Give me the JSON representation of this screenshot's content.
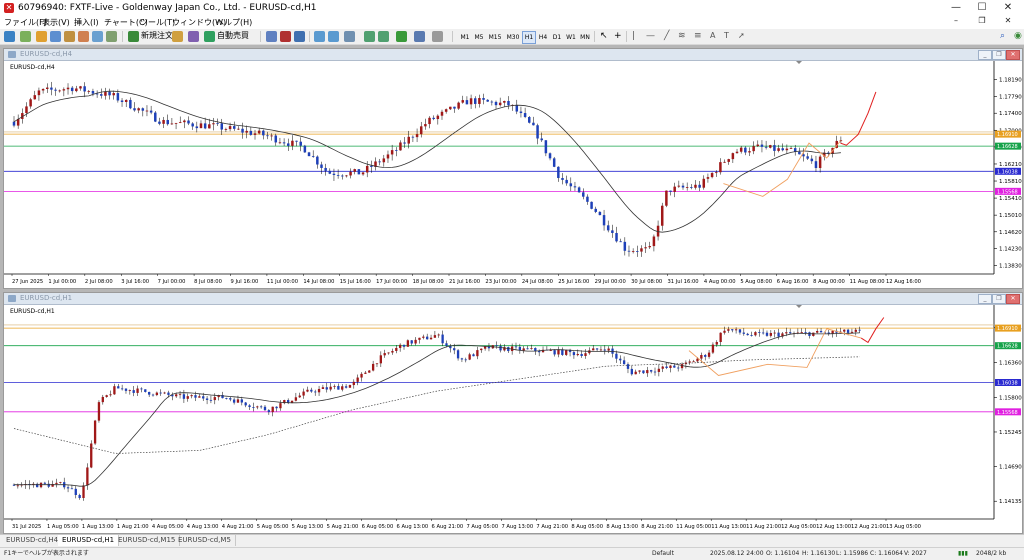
{
  "window": {
    "title": "60796940: FXTF-Live - Goldenway Japan Co., Ltd. - EURUSD-cd,H1",
    "minimize_glyph": "—",
    "maximize_glyph": "☐",
    "close_glyph": "✕",
    "app_icon": "mt4-app-icon"
  },
  "menu": [
    "ファイル(F)",
    "表示(V)",
    "挿入(I)",
    "チャート(C)",
    "ツール(T)",
    "ウィンドウ(W)",
    "ヘルプ(H)"
  ],
  "toolbar": {
    "new_order_label": "新規注文",
    "auto_trade_label": "自動売買",
    "timeframes": [
      "M1",
      "M5",
      "M15",
      "M30",
      "H1",
      "H4",
      "D1",
      "W1",
      "MN"
    ],
    "active_timeframe": "H1"
  },
  "chart_top": {
    "caption": "EURUSD-cd,H4",
    "symbol_label": "EURUSD-cd,H4",
    "price_ticks": [
      "1.18190",
      "1.17790",
      "1.17400",
      "1.17000",
      "1.16610",
      "1.16210",
      "1.15810",
      "1.15410",
      "1.15010",
      "1.14620",
      "1.14230",
      "1.13830"
    ],
    "price_tags": [
      {
        "text": "1.16910",
        "color": "#e8a020"
      },
      {
        "text": "1.16628",
        "color": "#16a34a"
      },
      {
        "text": "1.16038",
        "color": "#2a2ad0"
      },
      {
        "text": "1.15568",
        "color": "#e020e0"
      }
    ],
    "time_labels": [
      "27 Jun 2025",
      "1 Jul 00:00",
      "2 Jul 08:00",
      "3 Jul 16:00",
      "7 Jul 00:00",
      "8 Jul 08:00",
      "9 Jul 16:00",
      "11 Jul 00:00",
      "14 Jul 08:00",
      "15 Jul 16:00",
      "17 Jul 00:00",
      "18 Jul 08:00",
      "21 Jul 16:00",
      "23 Jul 00:00",
      "24 Jul 08:00",
      "25 Jul 16:00",
      "29 Jul 00:00",
      "30 Jul 08:00",
      "31 Jul 16:00",
      "4 Aug 00:00",
      "5 Aug 08:00",
      "6 Aug 16:00",
      "8 Aug 00:00",
      "11 Aug 08:00",
      "12 Aug 16:00"
    ]
  },
  "chart_bottom": {
    "caption": "EURUSD-cd,H1",
    "symbol_label": "EURUSD-cd,H1",
    "price_ticks": [
      "1.16915",
      "1.16360",
      "1.15800",
      "1.15245",
      "1.14690",
      "1.14135"
    ],
    "price_tags": [
      {
        "text": "1.16910",
        "color": "#e8a020"
      },
      {
        "text": "1.16628",
        "color": "#16a34a"
      },
      {
        "text": "1.16038",
        "color": "#2a2ad0"
      },
      {
        "text": "1.15568",
        "color": "#e020e0"
      }
    ],
    "time_labels": [
      "31 Jul 2025",
      "1 Aug 05:00",
      "1 Aug 13:00",
      "1 Aug 21:00",
      "4 Aug 05:00",
      "4 Aug 13:00",
      "4 Aug 21:00",
      "5 Aug 05:00",
      "5 Aug 13:00",
      "5 Aug 21:00",
      "6 Aug 05:00",
      "6 Aug 13:00",
      "6 Aug 21:00",
      "7 Aug 05:00",
      "7 Aug 13:00",
      "7 Aug 21:00",
      "8 Aug 05:00",
      "8 Aug 13:00",
      "8 Aug 21:00",
      "11 Aug 05:00",
      "11 Aug 13:00",
      "11 Aug 21:00",
      "12 Aug 05:00",
      "12 Aug 13:00",
      "12 Aug 21:00",
      "13 Aug 05:00"
    ]
  },
  "levels": [
    {
      "price": 1.1691,
      "color": "#e8a020"
    },
    {
      "price": 1.16628,
      "color": "#16a34a"
    },
    {
      "price": 1.16038,
      "color": "#2a2ad0"
    },
    {
      "price": 1.15568,
      "color": "#e020e0"
    }
  ],
  "colors": {
    "bull": "#a01818",
    "bear": "#1e40b8",
    "ma": "#333333",
    "projection": "#e02020",
    "swing": "#f0a060"
  },
  "tabs": [
    "EURUSD-cd,H4",
    "EURUSD-cd,H1",
    "EURUSD-cd,M15",
    "EURUSD-cd,M5"
  ],
  "active_tab": 1,
  "status": {
    "help": "F1キーでヘルプが表示されます",
    "profile": "Default",
    "datetime": "2025.08.12 24:00",
    "open": "O: 1.16104",
    "high": "H: 1.16130",
    "low": "L: 1.15986",
    "close": "C: 1.16064",
    "volume": "V: 2027",
    "traffic": "2048/2 kb"
  }
}
